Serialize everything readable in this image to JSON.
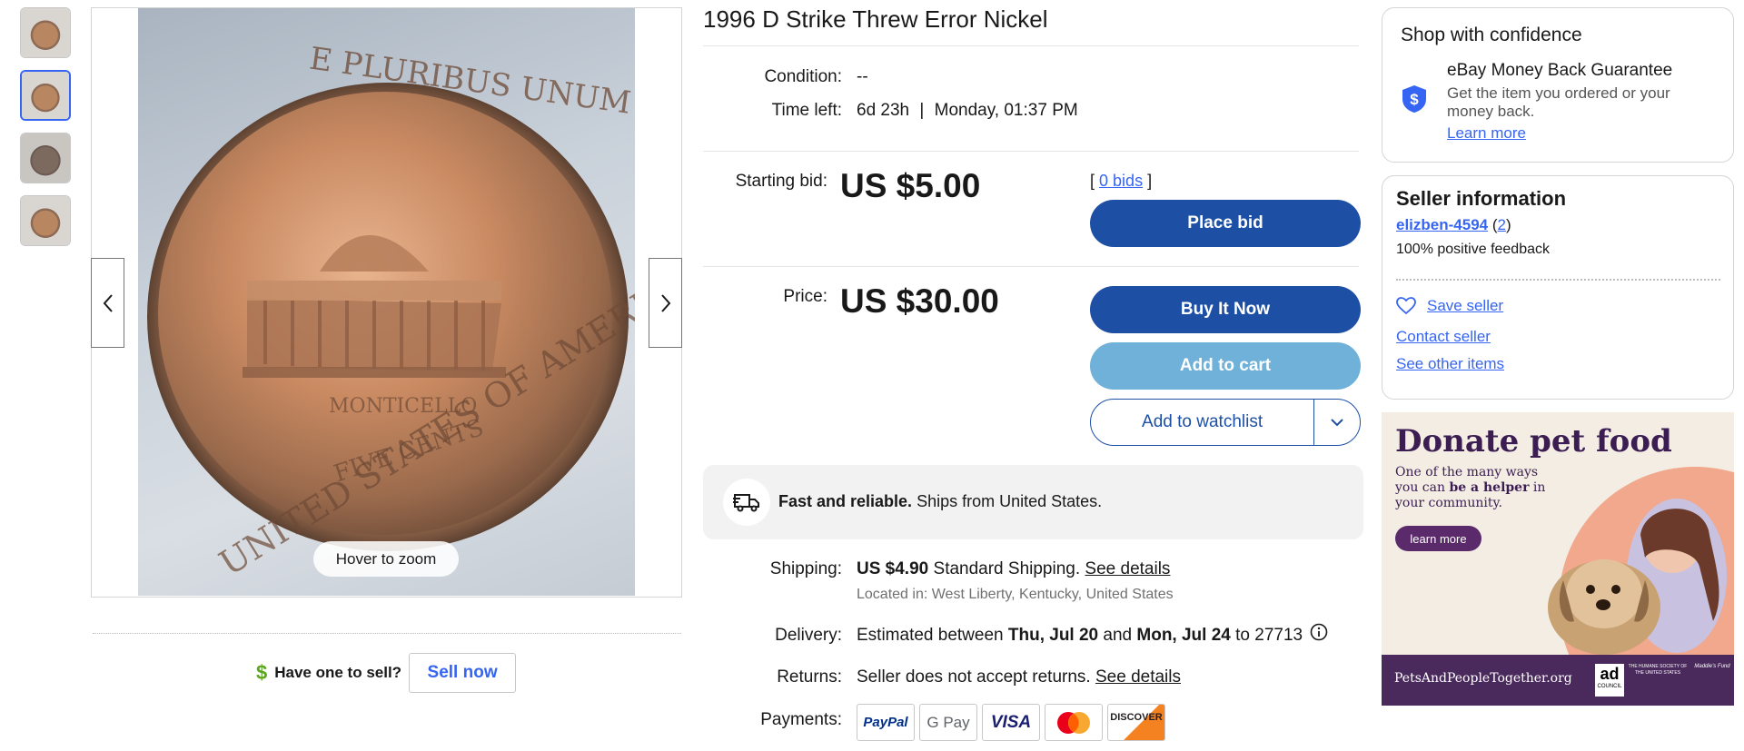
{
  "gallery": {
    "thumbnails": [
      "coin-thumb-1",
      "coin-thumb-2",
      "coin-thumb-3",
      "coin-thumb-4"
    ],
    "selected_index": 1,
    "zoom_hint": "Hover to zoom",
    "coin_text": {
      "top": "E PLURIBUS UNUM",
      "building": "MONTICELLO",
      "bottom": "UNITED STATES OF AMERICA",
      "denomination": "FIVE CENTS"
    }
  },
  "sell": {
    "prompt": "Have one to sell?",
    "button": "Sell now"
  },
  "listing": {
    "title": "1996 D Strike Threw Error Nickel",
    "condition_label": "Condition:",
    "condition_value": "--",
    "time_left_label": "Time left:",
    "time_left_value": "6d 23h",
    "time_left_sep": "|",
    "end_time": "Monday, 01:37 PM",
    "starting_bid_label": "Starting bid:",
    "starting_bid": "US $5.00",
    "bids_open": "[",
    "bids_link": "0 bids",
    "bids_close": "]",
    "place_bid": "Place bid",
    "price_label": "Price:",
    "price": "US $30.00",
    "buy_now": "Buy It Now",
    "add_to_cart": "Add to cart",
    "add_to_watchlist": "Add to watchlist"
  },
  "shipping_banner": {
    "bold": "Fast and reliable.",
    "text": "Ships from United States."
  },
  "details": {
    "shipping_label": "Shipping:",
    "shipping_cost": "US $4.90",
    "shipping_method": "Standard Shipping.",
    "shipping_link": "See details",
    "located": "Located in: West Liberty, Kentucky, United States",
    "delivery_label": "Delivery:",
    "delivery_prefix": "Estimated between",
    "delivery_start": "Thu, Jul 20",
    "delivery_and": "and",
    "delivery_end": "Mon, Jul 24",
    "delivery_to": "to 27713",
    "returns_label": "Returns:",
    "returns_text": "Seller does not accept returns.",
    "returns_link": "See details",
    "payments_label": "Payments:",
    "payments": [
      {
        "name": "PayPal",
        "color": "#003087"
      },
      {
        "name": "G Pay",
        "color": "#5f6368"
      },
      {
        "name": "VISA",
        "color": "#1a1f71"
      },
      {
        "name": "mastercard",
        "color": "#eb001b"
      },
      {
        "name": "DISCOVER",
        "color": "#f58220"
      }
    ]
  },
  "confidence": {
    "title": "Shop with confidence",
    "heading": "eBay Money Back Guarantee",
    "line1": "Get the item you ordered or your",
    "line2": "money back.",
    "link": "Learn more"
  },
  "seller": {
    "title": "Seller information",
    "name": "elizben-4594",
    "score_open": "(",
    "score": "2",
    "score_close": ")",
    "feedback": "100% positive feedback",
    "save": "Save seller",
    "contact": "Contact seller",
    "other_items": "See other items"
  },
  "ad": {
    "headline": "Donate pet food",
    "line1": "One of the many ways",
    "line2_pre": "you can",
    "line2_bold": "be a helper",
    "line2_post": "in",
    "line3": "your community.",
    "button": "learn more",
    "footer": "PetsAndPeopleTogether.org",
    "badge": "ad",
    "badge_sub": "COUNCIL",
    "partner1": "THE HUMANE SOCIETY OF THE UNITED STATES",
    "partner2": "Maddie's Fund"
  },
  "colors": {
    "primary_button": "#1d4fa5",
    "cart_button": "#6fb1d9",
    "link": "#3665f3",
    "ad_footer": "#4a2a5c"
  }
}
